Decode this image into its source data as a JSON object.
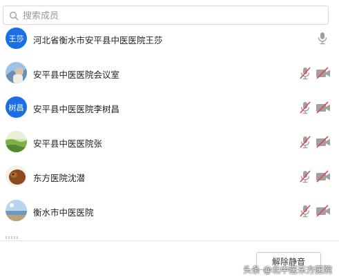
{
  "search": {
    "placeholder": "搜索成员"
  },
  "members": [
    {
      "name": "河北省衡水市安平县中医医院王莎",
      "avatar_text": "王莎",
      "mic": "on"
    },
    {
      "name": "安平县中医医院会议室",
      "avatar_text": "",
      "mic": "muted",
      "camera": "off"
    },
    {
      "name": "安平县中医医院李树昌",
      "avatar_text": "树昌",
      "mic": "muted",
      "camera": "off"
    },
    {
      "name": "安平县中医医院张",
      "avatar_text": "",
      "mic": "muted",
      "camera": "off"
    },
    {
      "name": "东方医院沈潜",
      "avatar_text": "",
      "mic": "muted",
      "camera": "off"
    },
    {
      "name": "衡水市中医医院",
      "avatar_text": "",
      "mic": "muted",
      "camera": "off"
    }
  ],
  "footer": {
    "unmute_label": "解除静音"
  },
  "watermark": "头条 @北中医东方医院",
  "colors": {
    "accent": "#1a6fe6",
    "muted_red": "#e0494b",
    "icon_gray": "#9a9a9a"
  }
}
